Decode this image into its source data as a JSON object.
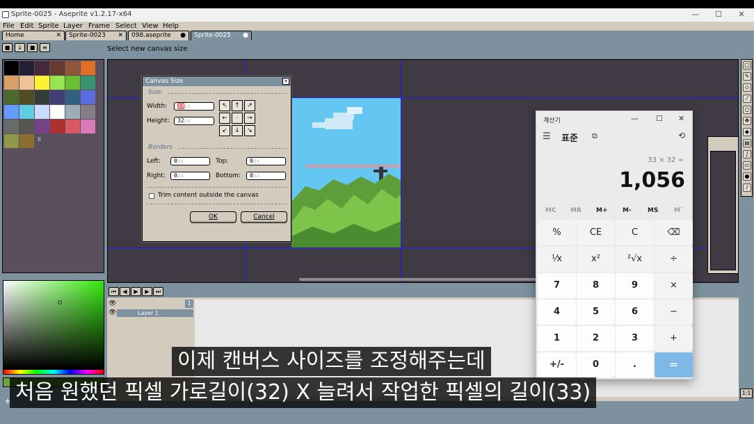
{
  "window": {
    "title": "Sprite-0025 - Aseprite v1.2.17-x64",
    "min": "—",
    "max": "☐",
    "close": "✕"
  },
  "menu": [
    "File",
    "Edit",
    "Sprite",
    "Layer",
    "Frame",
    "Select",
    "View",
    "Help"
  ],
  "tabs": [
    {
      "label": "Home",
      "mark": "✕"
    },
    {
      "label": "Sprite-0023",
      "mark": "✕"
    },
    {
      "label": "098.aseprite",
      "mark": "●"
    },
    {
      "label": "Sprite-0025",
      "mark": "●"
    }
  ],
  "status": "Select new canvas size",
  "palette": {
    "colors": [
      "#000000",
      "#222034",
      "#45283c",
      "#663931",
      "#8f563b",
      "#df7126",
      "#d9a066",
      "#eec39a",
      "#fbf236",
      "#99e550",
      "#6abe30",
      "#37946e",
      "#4b692f",
      "#524b24",
      "#323c39",
      "#3f3f74",
      "#306082",
      "#5b6ee1",
      "#639bff",
      "#5fcde4",
      "#cbdbfc",
      "#ffffff",
      "#9badb7",
      "#847e87",
      "#696a6a",
      "#595652",
      "#76428a",
      "#ac3232",
      "#d95763",
      "#d77bba",
      "#8f974a",
      "#8a6f30"
    ],
    "more": "II"
  },
  "dialog": {
    "title": "Canvas Size",
    "close": "✕",
    "size_section": "Size:",
    "width_label": "Width:",
    "width_value": "33",
    "width_unit": "px",
    "height_label": "Height:",
    "height_value": "32",
    "height_unit": "px",
    "borders_section": "Borders",
    "left_label": "Left:",
    "left_value": "0",
    "top_label": "Top:",
    "top_value": "0",
    "right_label": "Right:",
    "right_value": "0",
    "bottom_label": "Bottom:",
    "bottom_value": "0",
    "border_unit": "px",
    "trim_label": "Trim content outside the canvas",
    "ok": "OK",
    "cancel": "Cancel",
    "anchors": [
      "↖",
      "↑",
      "↗",
      "←",
      "·",
      "→",
      "↙",
      "↓",
      "↘"
    ]
  },
  "timeline": {
    "buttons": [
      "⏮",
      "◀",
      "▶",
      "▶",
      "⏭"
    ],
    "layer_name": "Layer 1",
    "frame_number": "1"
  },
  "calculator": {
    "title": "계산기",
    "min": "—",
    "max": "☐",
    "close": "✕",
    "mode": "표준",
    "expression": "33 × 32 =",
    "result": "1,056",
    "memory": [
      "MC",
      "MR",
      "M+",
      "M-",
      "MS",
      "M˅"
    ],
    "keys": [
      "%",
      "CE",
      "C",
      "⌫",
      "⅟x",
      "x²",
      "²√x",
      "÷",
      "7",
      "8",
      "9",
      "×",
      "4",
      "5",
      "6",
      "−",
      "1",
      "2",
      "3",
      "+",
      "+/-",
      "0",
      ".",
      "="
    ]
  },
  "subtitles": {
    "line1": "이제 캔버스 사이즈를 조정해주는데",
    "line2": "처음 원했던 픽셀 가로길이(32) X 늘려서 작업한 픽셀의 길이(33)"
  },
  "zoom_badge": "1:1"
}
